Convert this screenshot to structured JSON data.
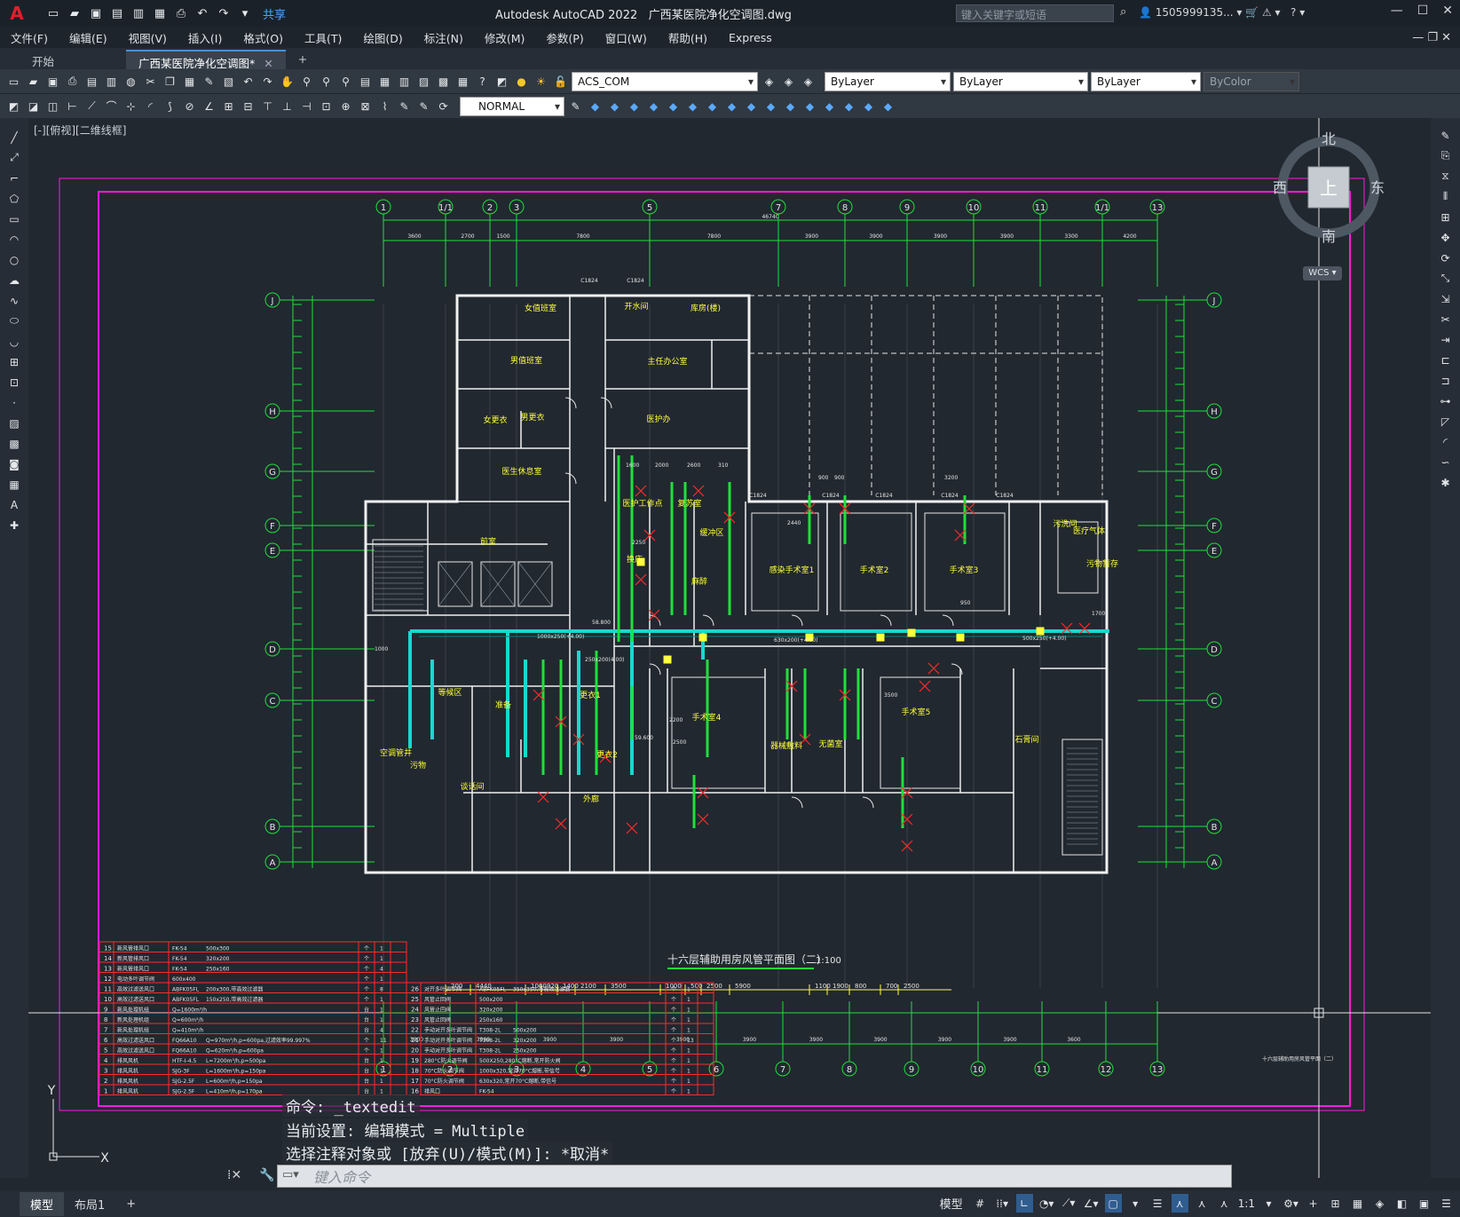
{
  "app": {
    "title": "Autodesk AutoCAD 2022",
    "file": "广西某医院净化空调图.dwg",
    "share": "共享",
    "search_placeholder": "键入关键字或短语",
    "user": "1505999135..."
  },
  "menu": [
    "文件(F)",
    "编辑(E)",
    "视图(V)",
    "插入(I)",
    "格式(O)",
    "工具(T)",
    "绘图(D)",
    "标注(N)",
    "修改(M)",
    "参数(P)",
    "窗口(W)",
    "帮助(H)",
    "Express"
  ],
  "tabs": [
    {
      "label": "开始"
    },
    {
      "label": "广西某医院净化空调图*"
    }
  ],
  "toolbar": {
    "layer": "ACS_COM",
    "color": "ByLayer",
    "linetype": "ByLayer",
    "lineweight": "ByLayer",
    "plotstyle": "ByColor",
    "dimstyle": "NORMAL"
  },
  "viewport": {
    "label": "[-][俯视][二维线框]"
  },
  "navcube": {
    "north": "北",
    "south": "南",
    "east": "东",
    "west": "西",
    "top": "上",
    "wcs": "WCS"
  },
  "drawing": {
    "title": "十六层辅助用房风管平面图（二）",
    "scale": "1:100",
    "top_axes": [
      "1",
      "1/1",
      "2",
      "3",
      "5",
      "7",
      "8",
      "9",
      "10",
      "11",
      "1/1",
      "13"
    ],
    "bottom_axes": [
      "1",
      "2",
      "3",
      "4",
      "5",
      "6",
      "7",
      "8",
      "9",
      "10",
      "11",
      "12",
      "13"
    ],
    "row_axes": [
      "J",
      "H",
      "G",
      "F",
      "E",
      "D",
      "C",
      "B",
      "A"
    ],
    "top_dims": [
      "3600",
      "2700",
      "1500",
      "7800",
      "7800",
      "3900",
      "3900",
      "3900",
      "3900",
      "3300",
      "4200"
    ],
    "overall_dim": "46740",
    "bottom_dims": [
      "200",
      "4440",
      "1060",
      "920",
      "1400",
      "2100",
      "3500",
      "1000",
      "500",
      "2500",
      "5900",
      "1100",
      "1900",
      "800",
      "700",
      "2500"
    ],
    "axis_dims": [
      "3900",
      "3900",
      "3900",
      "3900",
      "3900",
      "3900",
      "3900",
      "3900",
      "3900",
      "3900",
      "3600"
    ],
    "rooms": [
      "女值班室",
      "男值班室",
      "女更衣",
      "男更衣",
      "医生休息室",
      "开水间",
      "库房(楼)",
      "主任办公室",
      "医护办",
      "医护工作点",
      "复苏室",
      "缓冲区",
      "换床",
      "麻醉",
      "前室",
      "感染手术室1",
      "手术室2",
      "手术室3",
      "污洗间",
      "医疗气体",
      "污物暂存",
      "等候区",
      "准备",
      "更衣1",
      "更衣2",
      "谈话间",
      "外廊",
      "手术室4",
      "器械敷料",
      "无菌室",
      "手术室5",
      "石膏间",
      "空调管井",
      "污物"
    ],
    "door_tags": [
      "C1824",
      "C1824",
      "C1824",
      "C1824",
      "C1824",
      "C1824",
      "C1824"
    ],
    "duct_tags": [
      "1000x250(+4.00)",
      "250x200(4.00)",
      "630x200(+4.00)",
      "500x250(+4.00)",
      "2250",
      "1600",
      "2000",
      "2600",
      "310",
      "900",
      "900",
      "3200",
      "2440",
      "950",
      "1700",
      "2200",
      "2500",
      "3500",
      "58.800",
      "59.600"
    ],
    "sheet_label": "十六层辅助用房风管平面（二）"
  },
  "legend_left": [
    {
      "n": "15",
      "name": "新风管排风口",
      "code": "FK-54",
      "spec": "500x300",
      "u": "个",
      "q": "1"
    },
    {
      "n": "14",
      "name": "新风管排风口",
      "code": "FK-54",
      "spec": "320x200",
      "u": "个",
      "q": "1"
    },
    {
      "n": "13",
      "name": "新风管排风口",
      "code": "FK-54",
      "spec": "250x160",
      "u": "个",
      "q": "4"
    },
    {
      "n": "12",
      "name": "电动多叶调节阀",
      "code": "600x400",
      "spec": "",
      "u": "个",
      "q": "1"
    },
    {
      "n": "11",
      "name": "高效过滤送风口",
      "code": "ABFK05FL",
      "spec": "200x300,带高效过滤器",
      "u": "个",
      "q": "8"
    },
    {
      "n": "10",
      "name": "高效过滤送风口",
      "code": "ABFK05FL",
      "spec": "150x250,带高效过滤器",
      "u": "个",
      "q": "1"
    },
    {
      "n": "9",
      "name": "新风处理机组",
      "code": "Q=1600m³/h",
      "spec": "",
      "u": "台",
      "q": "1"
    },
    {
      "n": "8",
      "name": "新风处理机组",
      "code": "Q=600m³/h",
      "spec": "",
      "u": "台",
      "q": "1"
    },
    {
      "n": "7",
      "name": "新风处理机组",
      "code": "Q=410m³/h",
      "spec": "",
      "u": "台",
      "q": "4"
    },
    {
      "n": "6",
      "name": "高效过滤送风口",
      "code": "FQ66A10",
      "spec": "Q=970m³/h,p=600pa,过滤效率99.997%",
      "u": "个",
      "q": "11"
    },
    {
      "n": "5",
      "name": "高效过滤送风口",
      "code": "FQ66A10",
      "spec": "Q=620m³/h,p=600pa",
      "u": "个",
      "q": "1"
    },
    {
      "n": "4",
      "name": "排风风机",
      "code": "HTF-I-4.5",
      "spec": "L=7200m³/h,p=500pa",
      "u": "台",
      "q": "1"
    },
    {
      "n": "3",
      "name": "排风风机",
      "code": "SJG-3F",
      "spec": "L=1600m³/h,p=150pa",
      "u": "台",
      "q": "1"
    },
    {
      "n": "2",
      "name": "排风风机",
      "code": "SJG-2.5F",
      "spec": "L=600m³/h,p=150pa",
      "u": "台",
      "q": "1"
    },
    {
      "n": "1",
      "name": "排风风机",
      "code": "SJG-2.5F",
      "spec": "L=410m³/h,p=170pa",
      "u": "台",
      "q": "1"
    }
  ],
  "legend_right": [
    {
      "n": "26",
      "name": "对开多叶调节阀",
      "code": "ABFK05FL",
      "spec": "350x350,带高效过滤器",
      "u": "个",
      "q": "1"
    },
    {
      "n": "25",
      "name": "风管止回阀",
      "code": "500x200",
      "spec": "",
      "u": "个",
      "q": "1"
    },
    {
      "n": "24",
      "name": "风管止回阀",
      "code": "320x200",
      "spec": "",
      "u": "个",
      "q": "1"
    },
    {
      "n": "23",
      "name": "风管止回阀",
      "code": "250x160",
      "spec": "",
      "u": "个",
      "q": "1"
    },
    {
      "n": "22",
      "name": "手动对开多叶调节阀",
      "code": "T308-2L",
      "spec": "500x200",
      "u": "个",
      "q": "1"
    },
    {
      "n": "21",
      "name": "手动对开多叶调节阀",
      "code": "T308-2L",
      "spec": "320x200",
      "u": "个",
      "q": "13"
    },
    {
      "n": "20",
      "name": "手动对开多叶调节阀",
      "code": "T308-2L",
      "spec": "250x200",
      "u": "个",
      "q": "1"
    },
    {
      "n": "19",
      "name": "280°C防火调节阀",
      "code": "500X250,280°C熔断,常开防火阀",
      "spec": "",
      "u": "个",
      "q": "1"
    },
    {
      "n": "18",
      "name": "70°C防火调节阀",
      "code": "1000x320,常开70°C熔断,带信号",
      "spec": "",
      "u": "个",
      "q": "1"
    },
    {
      "n": "17",
      "name": "70°C防火调节阀",
      "code": "630x320,常开70°C熔断,带信号",
      "spec": "",
      "u": "个",
      "q": "1"
    },
    {
      "n": "16",
      "name": "排风口",
      "code": "FK-54",
      "spec": "",
      "u": "个",
      "q": "1"
    }
  ],
  "command": {
    "line1": "命令: _textedit",
    "line2": "当前设置: 编辑模式 = Multiple",
    "line3": "选择注释对象或 [放弃(U)/模式(M)]: *取消*",
    "placeholder": "键入命令"
  },
  "ucs": {
    "y": "Y",
    "x": "X"
  },
  "status": {
    "tabs": [
      "模型",
      "布局1",
      "+"
    ],
    "model": "模型",
    "scale": "1:1"
  }
}
